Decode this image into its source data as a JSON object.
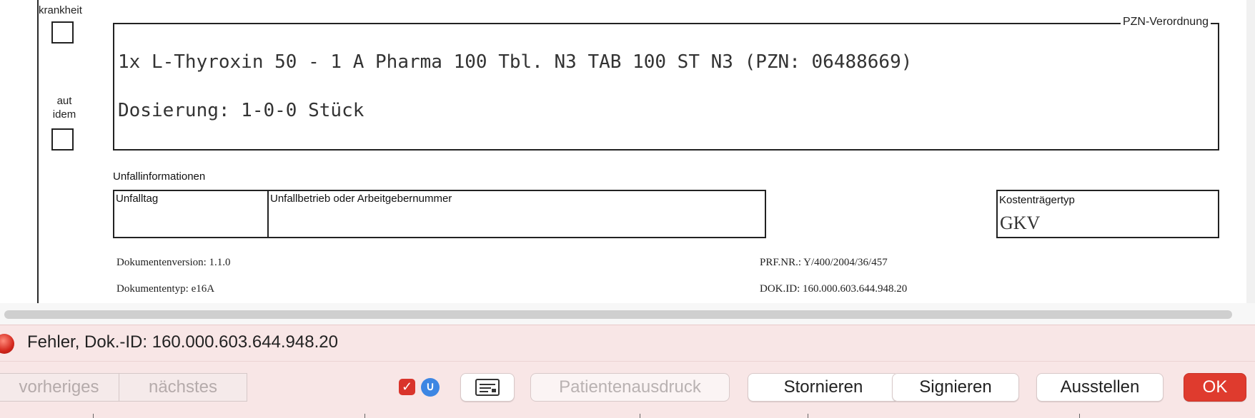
{
  "form": {
    "krankheit_label": "krankheit",
    "aut_idem_label_1": "aut",
    "aut_idem_label_2": "idem",
    "prescription_box_label": "PZN-Verordnung",
    "prescription_line": "1x L-Thyroxin 50 - 1 A Pharma 100 Tbl. N3 TAB 100 ST N3 (PZN: 06488669)",
    "dosage_line": "Dosierung: 1-0-0 Stück",
    "accident_section_title": "Unfallinformationen",
    "accident_day_label": "Unfalltag",
    "accident_company_label": "Unfallbetrieb oder Arbeitgebernummer",
    "payer_type_label": "Kostenträgertyp",
    "payer_type_value": "GKV",
    "doc_version": "Dokumentenversion:  1.1.0",
    "doc_type": "Dokumententyp:  e16A",
    "prf_nr": "PRF.NR.:  Y/400/2004/36/457",
    "dok_id": "DOK.ID:  160.000.603.644.948.20"
  },
  "status": {
    "error_text": "Fehler, Dok.-ID: 160.000.603.644.948.20",
    "error_color": "#d3261c"
  },
  "toolbar": {
    "previous_label": "vorheriges",
    "next_label": "nächstes",
    "patient_print_label": "Patientenausdruck",
    "cancel_label": "Stornieren",
    "sign_label": "Signieren",
    "issue_label": "Ausstellen",
    "ok_label": "OK",
    "ok_color": "#df3b2e",
    "checkbox_checked": true,
    "icons": [
      "checkbox-checked-icon",
      "stethoscope-icon",
      "card-icon"
    ]
  }
}
